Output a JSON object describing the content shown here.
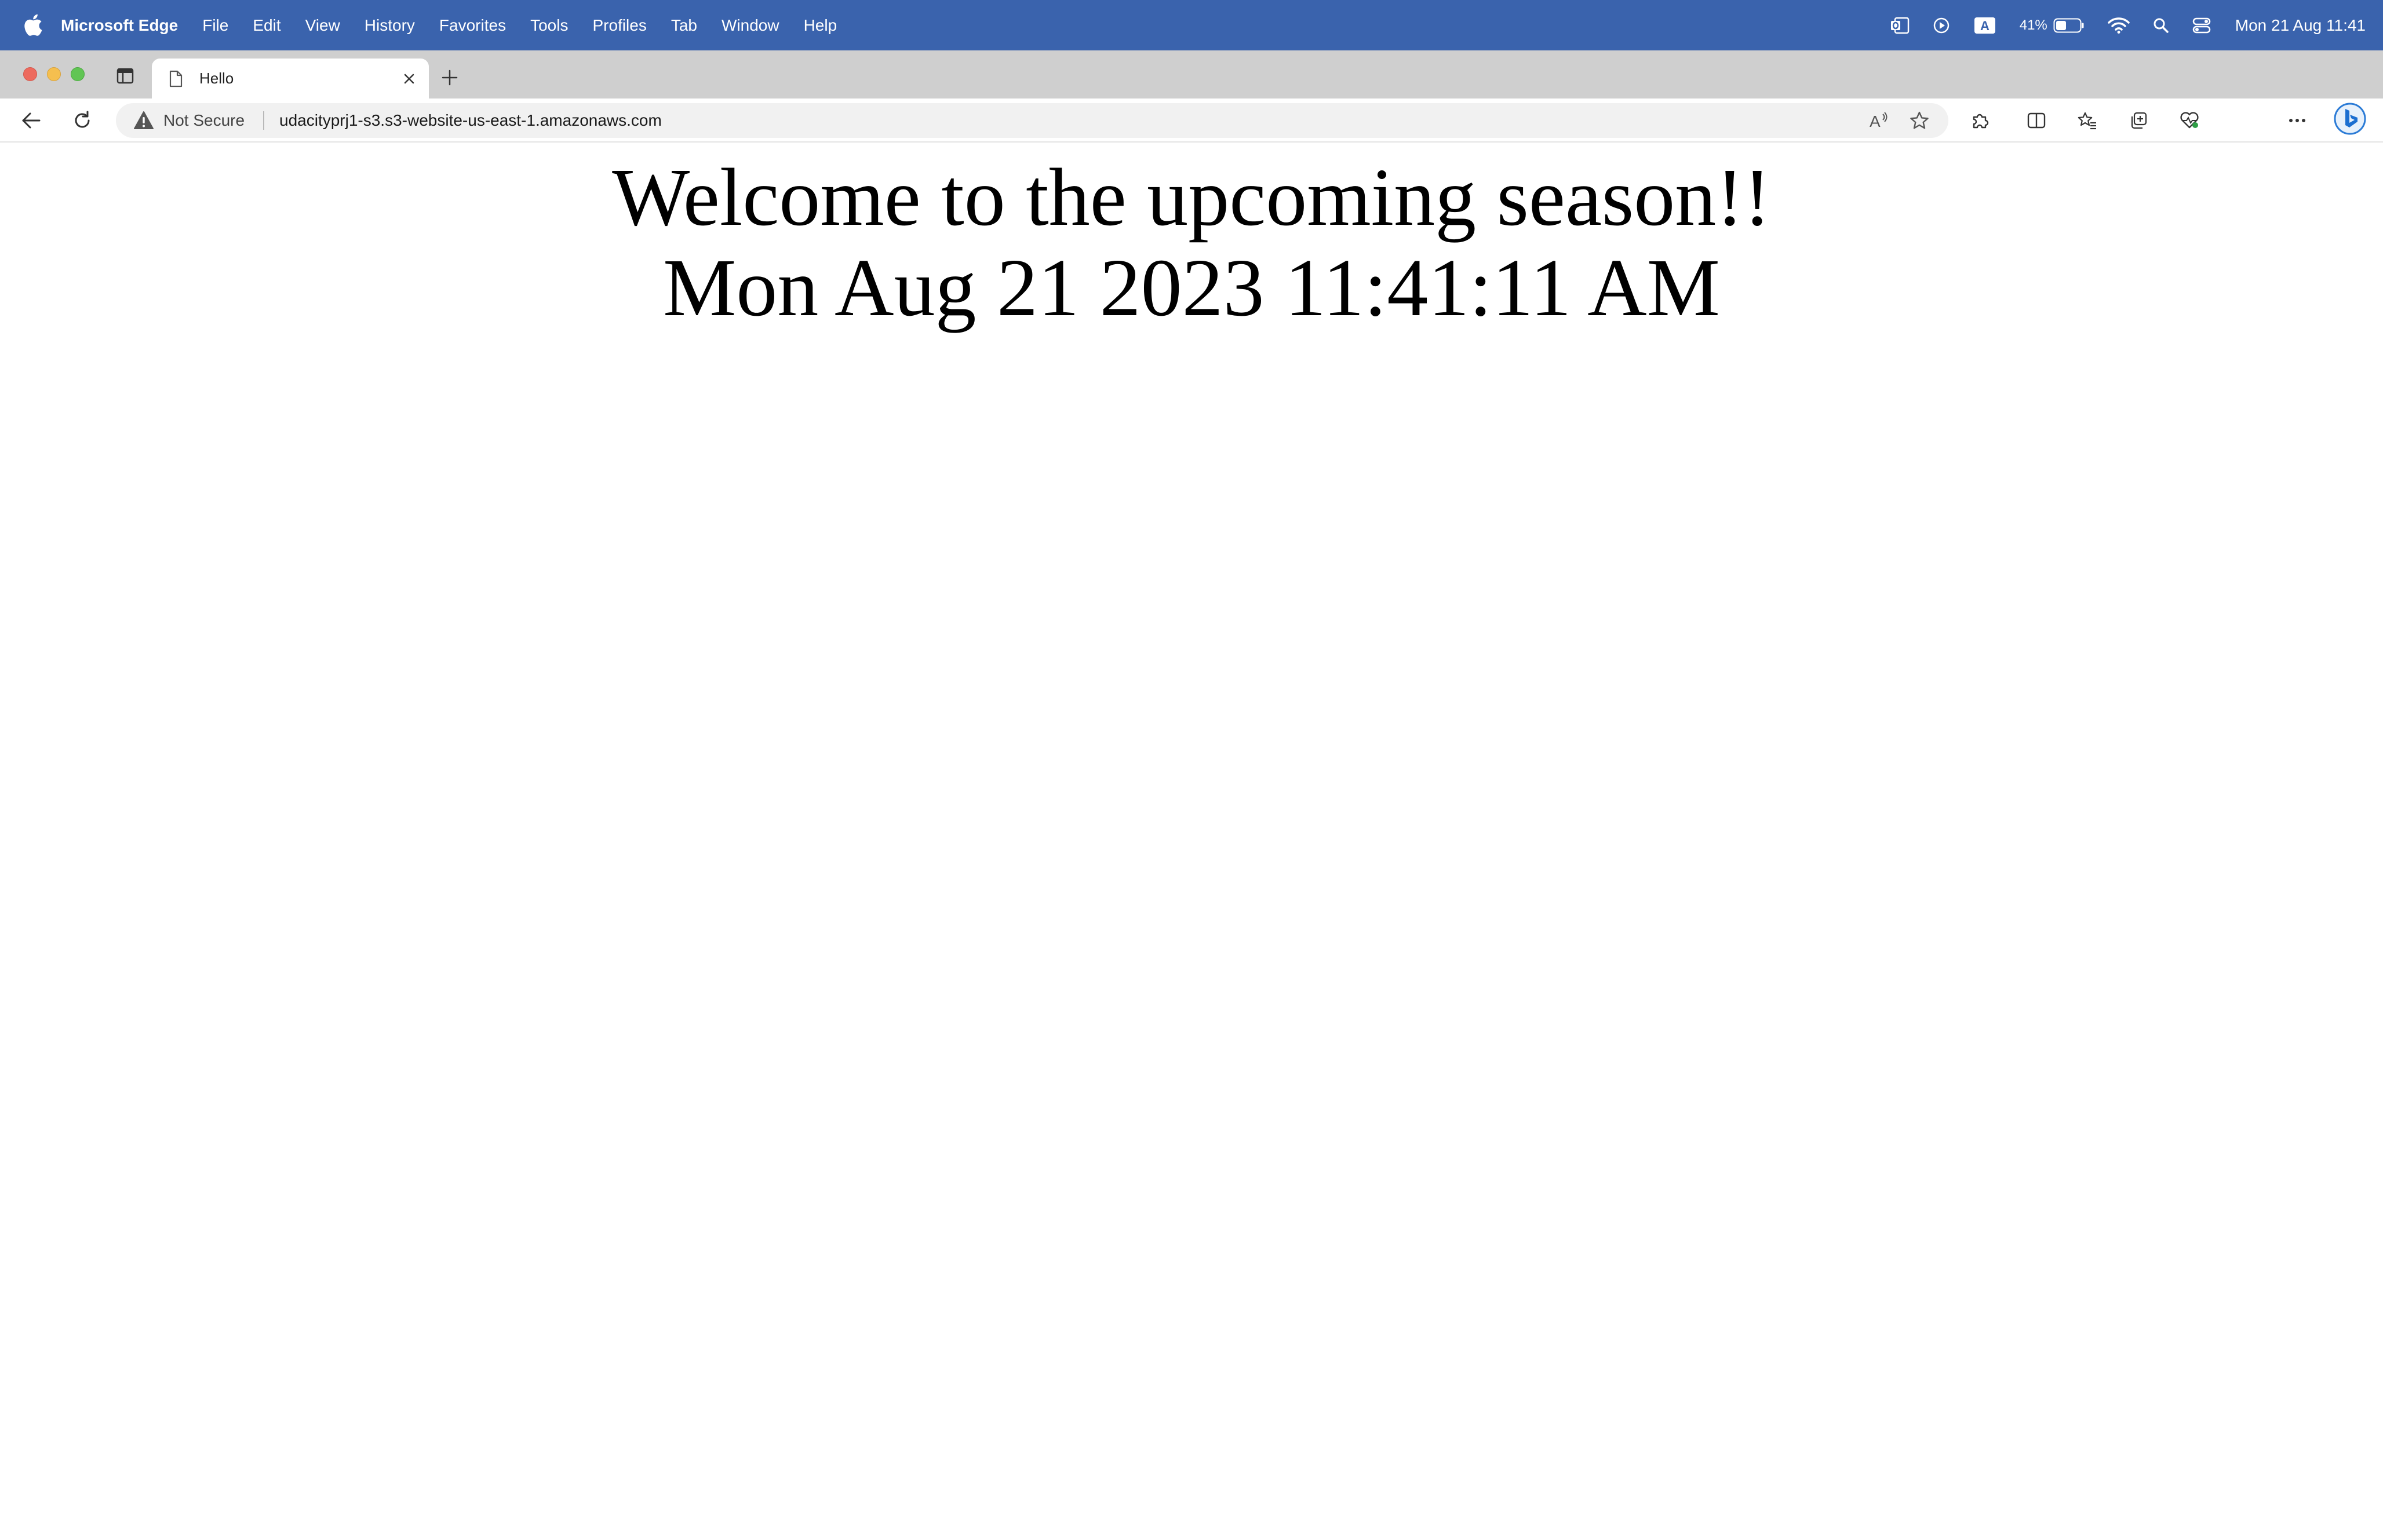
{
  "menubar": {
    "app_name": "Microsoft Edge",
    "menus": [
      "File",
      "Edit",
      "View",
      "History",
      "Favorites",
      "Tools",
      "Profiles",
      "Tab",
      "Window",
      "Help"
    ],
    "battery_percent": "41%",
    "clock": "Mon 21 Aug  11:41",
    "input_source": "A"
  },
  "tab": {
    "title": "Hello"
  },
  "addressbar": {
    "security_label": "Not Secure",
    "url": "udacityprj1-s3.s3-website-us-east-1.amazonaws.com"
  },
  "page": {
    "heading": "Welcome to the upcoming season!!",
    "datetime": "Mon Aug 21 2023 11:41:11 AM"
  },
  "colors": {
    "menubar": "#3a63ad",
    "tabstrip": "#cfcfcf",
    "page_background": "#ffffff"
  },
  "icons": [
    "apple-icon",
    "outlook-icon",
    "play-icon",
    "input-source-icon",
    "battery-icon",
    "wifi-icon",
    "spotlight-icon",
    "control-center-icon",
    "tab-actions-icon",
    "page-favicon-icon",
    "close-icon",
    "plus-icon",
    "back-icon",
    "refresh-icon",
    "warning-icon",
    "read-aloud-icon",
    "star-icon",
    "extensions-icon",
    "split-screen-icon",
    "favorites-icon",
    "collections-icon",
    "browser-essentials-icon",
    "more-icon",
    "bing-icon"
  ]
}
